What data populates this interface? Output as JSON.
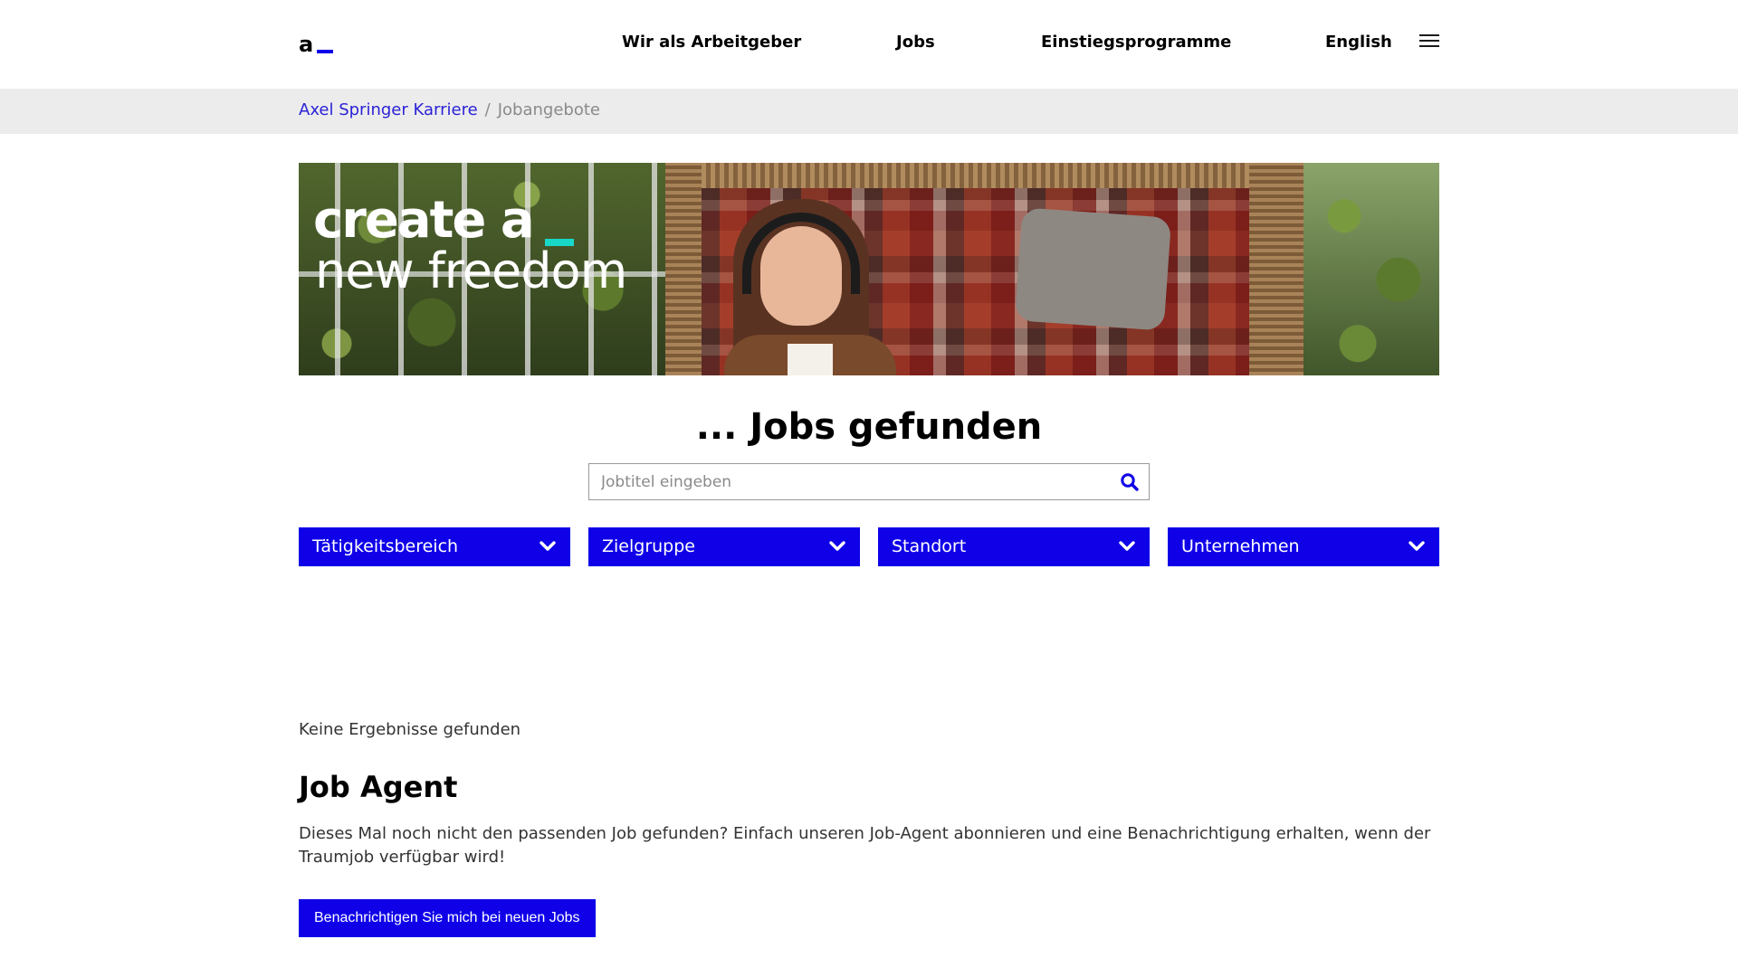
{
  "header": {
    "logo": {
      "letter": "a",
      "accent_color": "#0f00e8"
    },
    "nav": [
      {
        "label": "Wir als Arbeitgeber"
      },
      {
        "label": "Jobs"
      },
      {
        "label": "Einstiegsprogramme"
      },
      {
        "label": "English"
      }
    ],
    "menu_icon": "hamburger-menu-icon"
  },
  "breadcrumb": {
    "home": "Axel Springer Karriere",
    "separator": "/",
    "current": "Jobangebote"
  },
  "banner": {
    "line1": "create a",
    "line2": "new freedom",
    "accent_color": "#18d8c8"
  },
  "main": {
    "title": "... Jobs gefunden",
    "search": {
      "placeholder": "Jobtitel eingeben",
      "value": "",
      "icon": "search-icon"
    },
    "filters": [
      {
        "label": "Tätigkeitsbereich"
      },
      {
        "label": "Zielgruppe"
      },
      {
        "label": "Standort"
      },
      {
        "label": "Unternehmen"
      }
    ],
    "no_results": "Keine Ergebnisse gefunden"
  },
  "job_agent": {
    "title": "Job Agent",
    "text": "Dieses Mal noch nicht den passenden Job gefunden? Einfach unseren Job-Agent abonnieren und eine Benachrichtigung erhalten, wenn der Traumjob verfügbar wird!",
    "button": "Benachrichtigen Sie mich bei neuen Jobs"
  },
  "colors": {
    "primary": "#0f00e8",
    "link": "#2b22d6",
    "breadcrumb_bg": "#ececec"
  }
}
